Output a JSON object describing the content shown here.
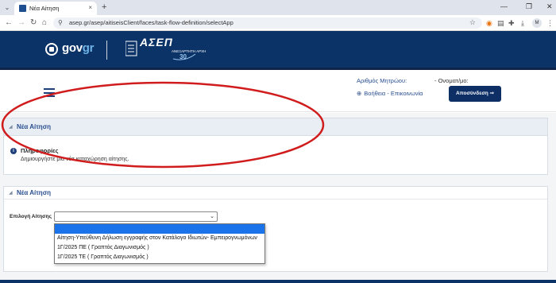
{
  "browser": {
    "tab_title": "Νέα Αίτηση",
    "tab_close": "×",
    "new_tab": "+",
    "url": "asep.gr/asep/aitiseisClient/faces/task-flow-definition/selectApp",
    "profile_initial": "M",
    "icons": [
      "search-tabs-icon",
      "back-icon",
      "forward-icon",
      "reload-icon",
      "home-icon",
      "site-info-icon",
      "star-icon",
      "rss-icon",
      "translate-icon",
      "extensions-icon",
      "download-icon",
      "sidepanel-icon",
      "menu-icon"
    ]
  },
  "banner": {
    "gov_main": "gov",
    "gov_accent": "gr",
    "asep_title": "ΑΣΕΠ",
    "asep_subtitle": "ΑΝΕΞΑΡΤΗΤΗ ΑΡΧΗ",
    "asep_years": "30"
  },
  "header": {
    "registry_label": "Αριθμός Μητρώου:",
    "name_label": "- Ονοματ/μο:",
    "help_link": "Βοήθεια - Επικοινωνία",
    "logout_button": "Αποσύνδεση ⇒"
  },
  "info_panel": {
    "title": "Νέα Αίτηση",
    "info_heading": "Πληροφορίες",
    "info_text": "Δημιουργήστε μία νέα καταχώρηση αίτησης."
  },
  "form_panel": {
    "title": "Νέα Αίτηση",
    "select_label": "Επιλογή Αίτησης",
    "selected_value": "",
    "options": [
      "",
      "Αίτηση-Υπεύθυνη Δήλωση εγγραφής στον Κατάλογο Ιδιωτών- Εμπειρογνωμόνων",
      "1Γ/2025 ΠΕ ( Γραπτός Διαγωνισμός )",
      "1Γ/2025 ΤΕ ( Γραπτός Διαγωνισμός )"
    ]
  },
  "colors": {
    "banner": "#0b3367",
    "accent_text": "#2a4f8f",
    "logout_bg": "#0d2f66",
    "annotation": "#d01c1c"
  }
}
